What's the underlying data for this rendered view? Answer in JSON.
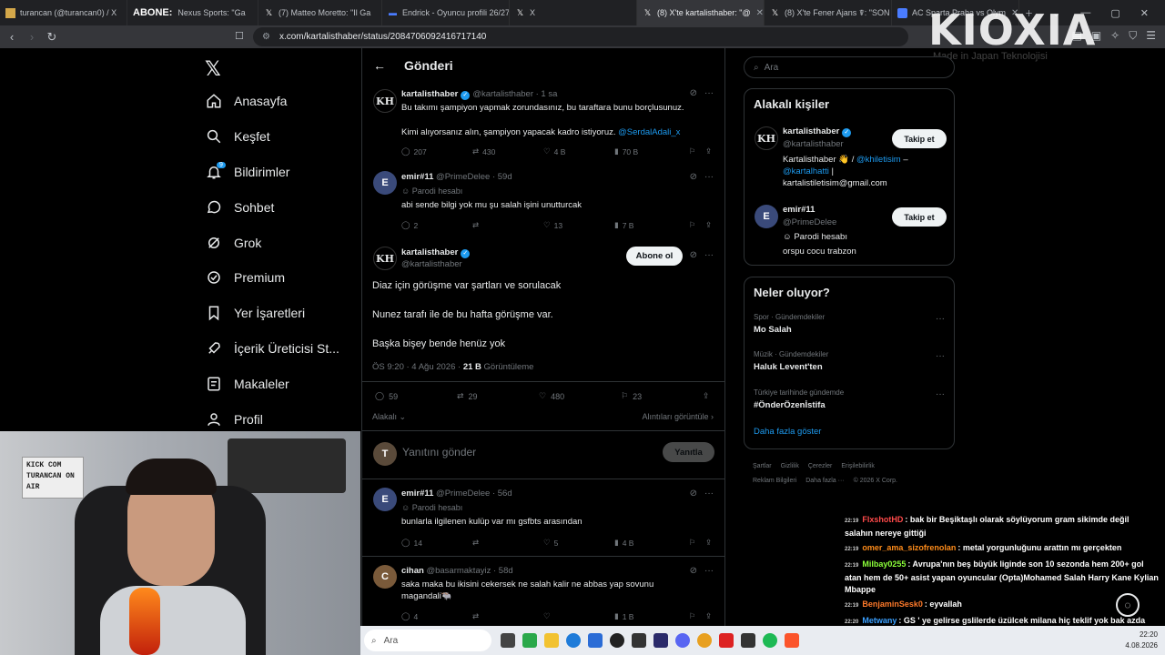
{
  "browser": {
    "tabs": [
      {
        "label": "turancan (@turancan0) / X",
        "active": false
      },
      {
        "label": "Nexus Sports: \"Ga",
        "active": false
      },
      {
        "label": "(7) Matteo Moretto: \"Il Ga",
        "active": false
      },
      {
        "label": "Endrick - Oyuncu profili 26/27",
        "active": false
      },
      {
        "label": "X",
        "active": false
      },
      {
        "label": "(8) X'te kartalisthaber: \"@",
        "active": true
      },
      {
        "label": "(8) X'te Fener Ajans ☤: \"SON D",
        "active": false
      },
      {
        "label": "AC Sparta Praha vs Olym",
        "active": false
      }
    ],
    "url": "x.com/kartalisthaber/status/2084706092416717140"
  },
  "overlay": {
    "brand": "KIOXIA",
    "brand_sub": "Made in Japan Teknolojisi",
    "tab_overlay": "ABONE:"
  },
  "nav": {
    "items": [
      {
        "label": "Anasayfa",
        "icon": "home-icon"
      },
      {
        "label": "Keşfet",
        "icon": "search-icon"
      },
      {
        "label": "Bildirimler",
        "icon": "bell-icon",
        "badge": "9"
      },
      {
        "label": "Sohbet",
        "icon": "chat-icon"
      },
      {
        "label": "Grok",
        "icon": "grok-icon"
      },
      {
        "label": "Premium",
        "icon": "premium-icon"
      },
      {
        "label": "Yer İşaretleri",
        "icon": "bookmark-icon"
      },
      {
        "label": "İçerik Üreticisi St...",
        "icon": "rocket-icon"
      },
      {
        "label": "Makaleler",
        "icon": "article-icon"
      },
      {
        "label": "Profil",
        "icon": "profile-icon"
      }
    ]
  },
  "main": {
    "title": "Gönderi",
    "parent_post": {
      "name": "kartalisthaber",
      "handle": "@kartalisthaber",
      "time": "· 1 sa",
      "line1": "Bu takımı şampiyon yapmak zorundasınız, bu taraftara bunu borçlusunuz.",
      "line2": "Kimi alıyorsanız alın, şampiyon yapacak kadro istiyoruz.",
      "mention": "@SerdalAdali_x",
      "replies": "207",
      "reposts": "430",
      "likes": "4 B",
      "views": "70 B"
    },
    "reply_emir_1": {
      "name": "emir#11",
      "handle": "@PrimeDelee",
      "time": "· 59d",
      "parody": "Parodi hesabı",
      "text": "abi sende bilgi yok mu şu salah işini unutturcak",
      "replies": "2",
      "reposts": "",
      "likes": "13",
      "views": "7 B"
    },
    "main_post": {
      "name": "kartalisthaber",
      "handle": "@kartalisthaber",
      "subscribe_label": "Abone ol",
      "line1": "Diaz için görüşme var şartları ve sorulacak",
      "line2": "Nunez tarafı ile de bu hafta görüşme var.",
      "line3": "Başka bişey bende henüz yok",
      "timestamp": "ÖS 9:20 · 4 Ağu 2026 ·",
      "views_count": "21 B",
      "views_label": "Görüntüleme",
      "replies": "59",
      "reposts": "29",
      "likes": "480",
      "bookmarks": "23",
      "quality": "Alakalı",
      "quotes": "Alıntıları görüntüle"
    },
    "compose": {
      "placeholder": "Yanıtını gönder",
      "button": "Yanıtla"
    },
    "reply_emir_2": {
      "name": "emir#11",
      "handle": "@PrimeDelee",
      "time": "· 56d",
      "parody": "Parodi hesabı",
      "text": "bunlarla ilgilenen kulüp var mı gsfbts arasından",
      "replies": "14",
      "reposts": "",
      "likes": "5",
      "views": "4 B"
    },
    "reply_cihan": {
      "name": "cihan",
      "handle": "@basarmaktayiz",
      "time": "· 58d",
      "line1": "saka maka bu ikisini cekersek ne salah kalir ne abbas yap sovunu",
      "line2": "magandali🐃",
      "replies": "4",
      "reposts": "",
      "likes": "",
      "views": "1 B"
    }
  },
  "right": {
    "search_placeholder": "Ara",
    "related_title": "Alakalı kişiler",
    "person1": {
      "name": "kartalisthaber",
      "handle": "@kartalisthaber",
      "bio_start": "Kartalisthaber 👋 /",
      "bio_m1": "@khiletisim",
      "bio_dash": " –",
      "bio_m2": "@kartalhatti",
      "bio_sep": " |",
      "bio_email": "kartalistiletisim@gmail.com",
      "follow": "Takip et"
    },
    "person2": {
      "name": "emir#11",
      "handle": "@PrimeDelee",
      "parody": "Parodi hesabı",
      "bio": "orspu cocu trabzon",
      "follow": "Takip et"
    },
    "trends_title": "Neler oluyor?",
    "trends": [
      {
        "category": "Spor · Gündemdekiler",
        "name": "Mo Salah"
      },
      {
        "category": "Müzik · Gündemdekiler",
        "name": "Haluk Levent'ten"
      },
      {
        "category": "Türkiye tarihinde gündemde",
        "name": "#ÖnderÖzenİstifa"
      }
    ],
    "show_more": "Daha fazla göster",
    "footer1": [
      "Şartlar",
      "Gizlilik",
      "Çerezler",
      "Erişilebilirlik"
    ],
    "footer2": [
      "Reklam Bilgileri",
      "Daha fazla ···",
      "© 2026 X Corp."
    ]
  },
  "chat": [
    {
      "time": "22:19",
      "user": "FlxshotHD",
      "color": "#ff4a4a",
      "msg": ": bak bir Beşiktaşlı olarak söylüyorum gram sikimde değil salahın nereye gittiği"
    },
    {
      "time": "22:19",
      "user": "omer_ama_sizofrenolan",
      "color": "#ff8c1a",
      "msg": ": metal yorgunluğunu arattın mı gerçekten"
    },
    {
      "time": "22:19",
      "user": "Milbay0255",
      "color": "#8cff3a",
      "msg": ": Avrupa'nın beş büyük liginde son 10 sezonda hem 200+ gol atan hem de 50+ asist yapan oyuncular (Opta)Mohamed Salah Harry Kane Kylian Mbappe"
    },
    {
      "time": "22:19",
      "user": "BenjaminSesk0",
      "color": "#ff7a2a",
      "msg": ": eyvallah"
    },
    {
      "time": "22:20",
      "user": "Metwany",
      "color": "#3aa0ff",
      "msg": ": GS ' ye gelirse gslilerde üzülcek milana hiç teklif yok bak azda değil hiç yok avrupa dan çocuk çok problemli maaş fazla istiyor anlamıyosunuz izlemiyosunuz @Turancan"
    }
  ],
  "taskbar": {
    "search": "Ara",
    "time": "22:20",
    "date": "4.08.2026"
  },
  "webcam": {
    "sign_text": "KICK COM TURANCAN ON AIR"
  }
}
